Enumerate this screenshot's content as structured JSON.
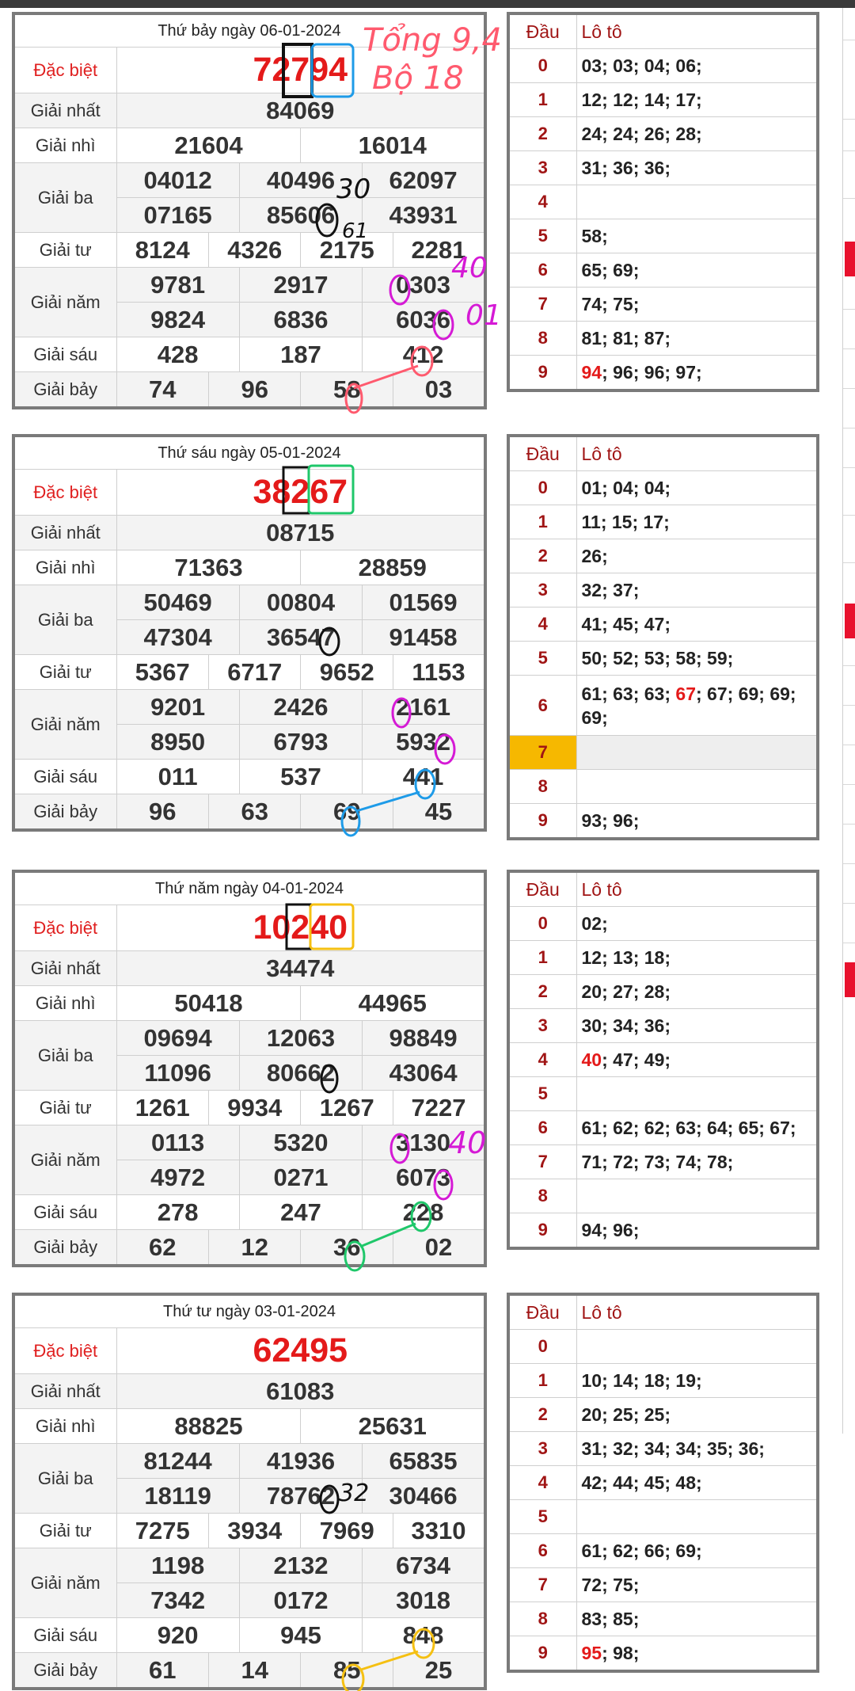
{
  "draws": [
    {
      "date": "Thứ bảy ngày 06-01-2024",
      "special": "72794",
      "first": "84069",
      "second": [
        "21604",
        "16014"
      ],
      "third": [
        "04012",
        "40496",
        "62097",
        "07165",
        "85606",
        "43931"
      ],
      "fourth": [
        "8124",
        "4326",
        "2175",
        "2281"
      ],
      "fifth": [
        "9781",
        "2917",
        "0303",
        "9824",
        "6836",
        "6036"
      ],
      "sixth": [
        "428",
        "187",
        "412"
      ],
      "seventh": [
        "74",
        "96",
        "58",
        "03"
      ],
      "loto": [
        {
          "d": "0",
          "v": "03; 03; 04; 06;"
        },
        {
          "d": "1",
          "v": "12; 12; 14; 17;"
        },
        {
          "d": "2",
          "v": "24; 24; 26; 28;"
        },
        {
          "d": "3",
          "v": "31; 36; 36;"
        },
        {
          "d": "4",
          "v": ""
        },
        {
          "d": "5",
          "v": "58;"
        },
        {
          "d": "6",
          "v": "65; 69;"
        },
        {
          "d": "7",
          "v": "74; 75;"
        },
        {
          "d": "8",
          "v": "81; 81; 87;"
        },
        {
          "d": "9",
          "v_red": "94",
          "v": "; 96; 96; 97;"
        }
      ]
    },
    {
      "date": "Thứ sáu ngày 05-01-2024",
      "special": "38267",
      "first": "08715",
      "second": [
        "71363",
        "28859"
      ],
      "third": [
        "50469",
        "00804",
        "01569",
        "47304",
        "36547",
        "91458"
      ],
      "fourth": [
        "5367",
        "6717",
        "9652",
        "1153"
      ],
      "fifth": [
        "9201",
        "2426",
        "2161",
        "8950",
        "6793",
        "5932"
      ],
      "sixth": [
        "011",
        "537",
        "441"
      ],
      "seventh": [
        "96",
        "63",
        "69",
        "45"
      ],
      "loto": [
        {
          "d": "0",
          "v": "01; 04; 04;"
        },
        {
          "d": "1",
          "v": "11; 15; 17;"
        },
        {
          "d": "2",
          "v": "26;"
        },
        {
          "d": "3",
          "v": "32; 37;"
        },
        {
          "d": "4",
          "v": "41; 45; 47;"
        },
        {
          "d": "5",
          "v": "50; 52; 53; 58; 59;"
        },
        {
          "d": "6",
          "v_pre": "61; 63; 63; ",
          "v_red": "67",
          "v": "; 67; 69; 69; 69;"
        },
        {
          "d": "7",
          "v": ""
        },
        {
          "d": "8",
          "v": ""
        },
        {
          "d": "9",
          "v": "93; 96;"
        }
      ]
    },
    {
      "date": "Thứ năm ngày 04-01-2024",
      "special": "10240",
      "first": "34474",
      "second": [
        "50418",
        "44965"
      ],
      "third": [
        "09694",
        "12063",
        "98849",
        "11096",
        "80662",
        "43064"
      ],
      "fourth": [
        "1261",
        "9934",
        "1267",
        "7227"
      ],
      "fifth": [
        "0113",
        "5320",
        "3130",
        "4972",
        "0271",
        "6073"
      ],
      "sixth": [
        "278",
        "247",
        "228"
      ],
      "seventh": [
        "62",
        "12",
        "36",
        "02"
      ],
      "loto": [
        {
          "d": "0",
          "v": "02;"
        },
        {
          "d": "1",
          "v": "12; 13; 18;"
        },
        {
          "d": "2",
          "v": "20; 27; 28;"
        },
        {
          "d": "3",
          "v": "30; 34; 36;"
        },
        {
          "d": "4",
          "v_red": "40",
          "v": "; 47; 49;"
        },
        {
          "d": "5",
          "v": ""
        },
        {
          "d": "6",
          "v": "61; 62; 62; 63; 64; 65; 67;"
        },
        {
          "d": "7",
          "v": "71; 72; 73; 74; 78;"
        },
        {
          "d": "8",
          "v": ""
        },
        {
          "d": "9",
          "v": "94; 96;"
        }
      ]
    },
    {
      "date": "Thứ tư ngày 03-01-2024",
      "special": "62495",
      "first": "61083",
      "second": [
        "88825",
        "25631"
      ],
      "third": [
        "81244",
        "41936",
        "65835",
        "18119",
        "78762",
        "30466"
      ],
      "fourth": [
        "7275",
        "3934",
        "7969",
        "3310"
      ],
      "fifth": [
        "1198",
        "2132",
        "6734",
        "7342",
        "0172",
        "3018"
      ],
      "sixth": [
        "920",
        "945",
        "848"
      ],
      "seventh": [
        "61",
        "14",
        "85",
        "25"
      ],
      "loto": [
        {
          "d": "0",
          "v": ""
        },
        {
          "d": "1",
          "v": "10; 14; 18; 19;"
        },
        {
          "d": "2",
          "v": "20; 25; 25;"
        },
        {
          "d": "3",
          "v": "31; 32; 34; 34; 35; 36;"
        },
        {
          "d": "4",
          "v": "42; 44; 45; 48;"
        },
        {
          "d": "5",
          "v": ""
        },
        {
          "d": "6",
          "v": "61; 62; 66; 69;"
        },
        {
          "d": "7",
          "v": "72; 75;"
        },
        {
          "d": "8",
          "v": "83; 85;"
        },
        {
          "d": "9",
          "v_red": "95",
          "v": "; 98;"
        }
      ]
    }
  ],
  "labels": {
    "special": "Đặc biệt",
    "first": "Giải nhất",
    "second": "Giải nhì",
    "third": "Giải ba",
    "fourth": "Giải tư",
    "fifth": "Giải năm",
    "sixth": "Giải sáu",
    "seventh": "Giải bảy",
    "dau": "Đầu",
    "loto": "Lô tô"
  },
  "annotations": {
    "tong": "Tổng 9,4",
    "bo": "Bộ 18",
    "n30": "30",
    "n61": "61",
    "n40": "40",
    "n01": "01",
    "n40b": "40",
    "n32": "32"
  },
  "colors": {
    "special": "#e41a1a",
    "dau": "#a01515",
    "highlight": "#f6b800",
    "ink_red": "#ff5a6e",
    "ink_magenta": "#d51ad5",
    "ink_cyan": "#1e9be8",
    "ink_green": "#1fc76a",
    "ink_yellow": "#f5c012",
    "ink_black": "#111111"
  }
}
